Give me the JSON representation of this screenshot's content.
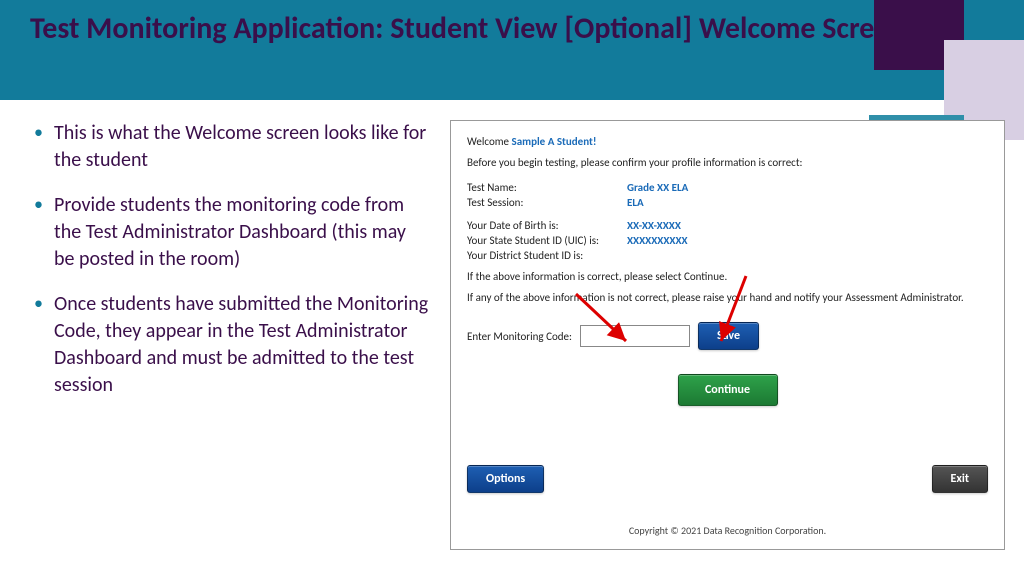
{
  "header": {
    "title": "Test Monitoring Application: Student View [Optional] Welcome Screen"
  },
  "bullets": [
    "This is what the Welcome screen looks like for the student",
    "Provide students the monitoring code from the Test Administrator Dashboard (this may be posted in the room)",
    "Once students have submitted the Monitoring Code, they appear in the Test Administrator Dashboard and must be admitted to the test session"
  ],
  "app": {
    "welcome_prefix": "Welcome ",
    "student_name": "Sample A Student!",
    "confirm_text": "Before you begin testing, please confirm your profile information is correct:",
    "fields": {
      "test_name_label": "Test Name:",
      "test_name_value": "Grade XX ELA",
      "test_session_label": "Test Session:",
      "test_session_value": "ELA",
      "dob_label": "Your Date of Birth is:",
      "dob_value": "XX-XX-XXXX",
      "uic_label": "Your State Student ID (UIC) is:",
      "uic_value": "XXXXXXXXXX",
      "district_label": "Your District Student ID is:",
      "district_value": ""
    },
    "instr_correct": "If the above information is correct, please select Continue.",
    "instr_incorrect": "If any of the above information is not correct, please raise your hand and notify your Assessment Administrator.",
    "code_label": "Enter Monitoring Code:",
    "code_value": "",
    "save_label": "Save",
    "continue_label": "Continue",
    "options_label": "Options",
    "exit_label": "Exit",
    "copyright": "Copyright © 2021 Data Recognition Corporation."
  }
}
